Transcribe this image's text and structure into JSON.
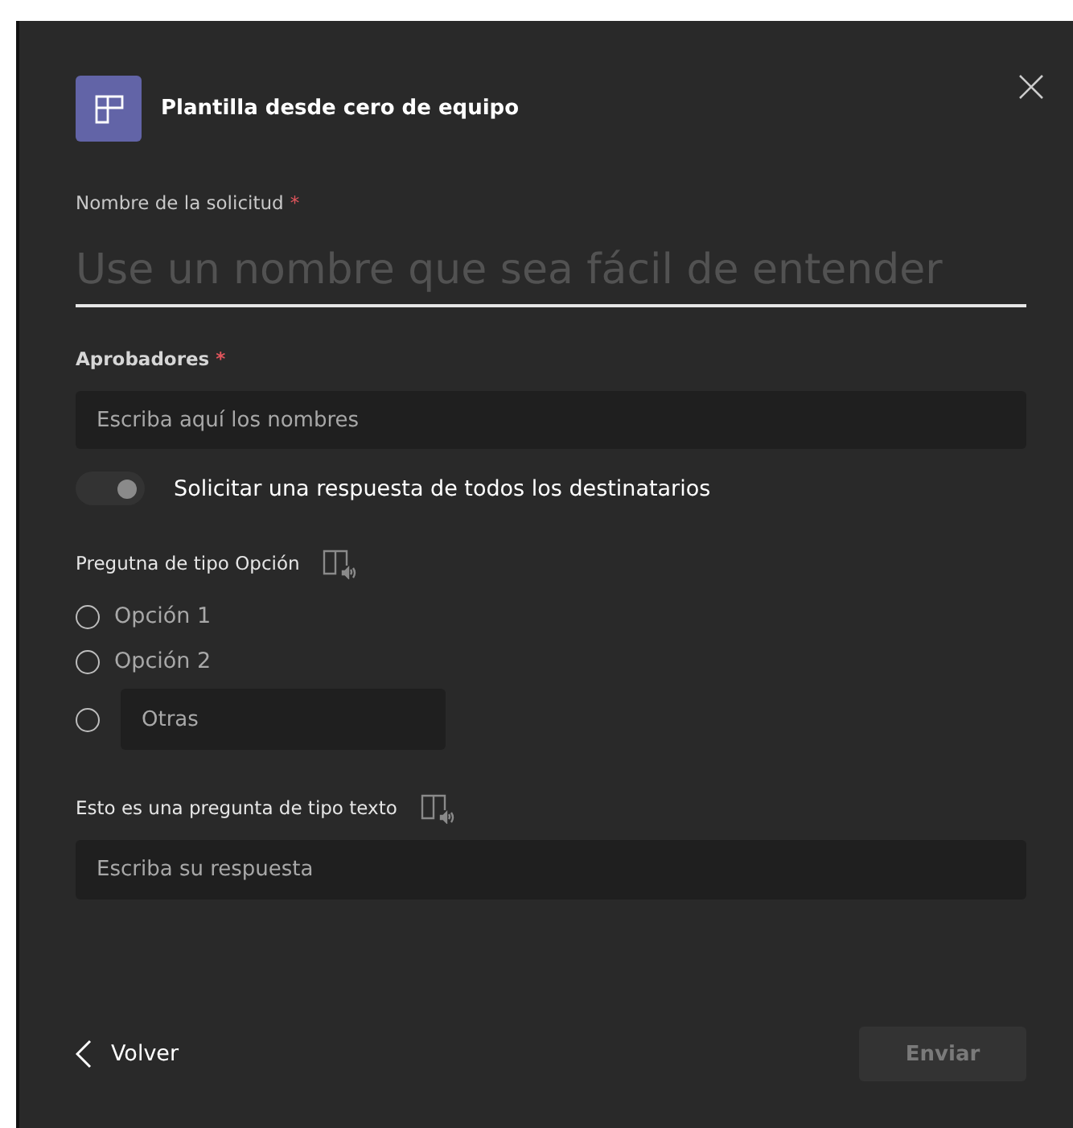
{
  "dialog": {
    "title": "Plantilla desde cero de equipo"
  },
  "request_name": {
    "label": "Nombre de la solicitud",
    "required_mark": "*",
    "placeholder": "Use un nombre que sea fácil de entender"
  },
  "approvers": {
    "label": "Aprobadores",
    "required_mark": "*",
    "placeholder": "Escriba aquí los nombres"
  },
  "toggle": {
    "label": "Solicitar una respuesta de todos los destinatarios",
    "on": true,
    "disabled": true
  },
  "choice_question": {
    "label": "Pregutna de tipo Opción",
    "options": [
      {
        "kind": "option",
        "label": "Opción 1",
        "selected": false
      },
      {
        "kind": "option",
        "label": "Opción 2",
        "selected": false
      },
      {
        "kind": "other",
        "placeholder": "Otras",
        "selected": false
      }
    ]
  },
  "text_question": {
    "label": "Esto es una pregunta de tipo texto",
    "placeholder": "Escriba su respuesta"
  },
  "footer": {
    "back": "Volver",
    "submit": {
      "label": "Enviar",
      "disabled": true
    }
  }
}
